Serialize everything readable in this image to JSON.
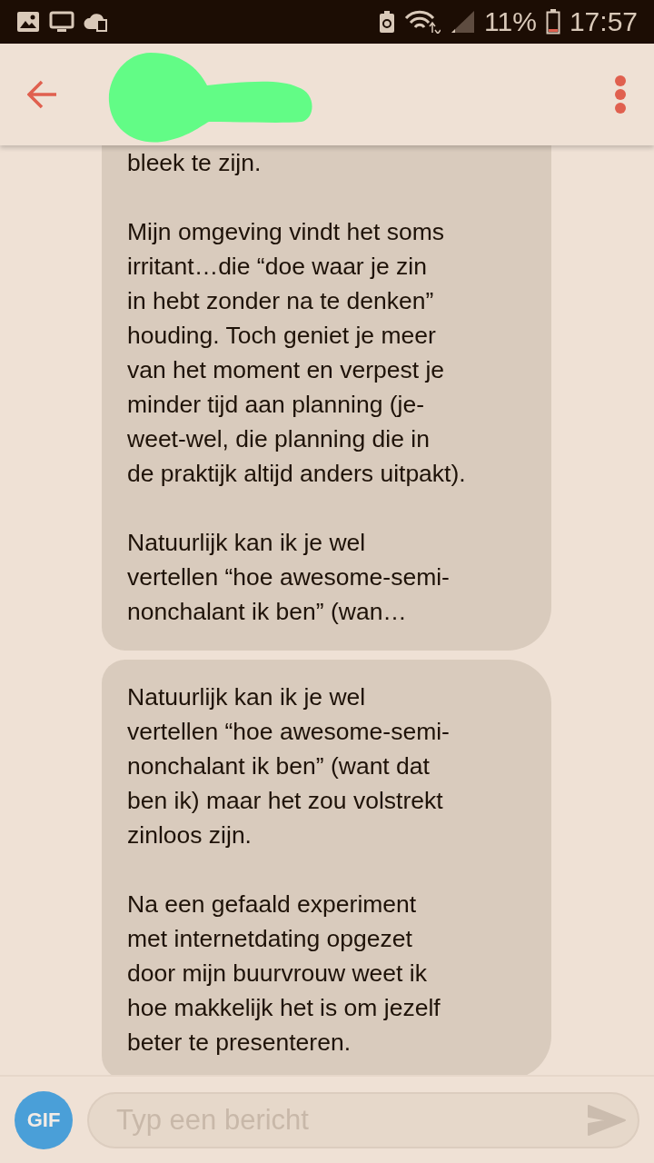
{
  "status_bar": {
    "battery": "11%",
    "time": "17:57"
  },
  "messages": [
    {
      "paragraphs": [
        "bleek te zijn.",
        "Mijn omgeving vindt het soms\nirritant…die “doe waar je zin\nin hebt zonder na te denken”\nhouding. Toch geniet je meer\nvan het moment en verpest je\nminder tijd aan planning (je-\nweet-wel, die planning die in\nde praktijk altijd anders uitpakt).",
        "Natuurlijk kan ik je wel\nvertellen “hoe awesome-semi-\nnonchalant ik ben” (wan…"
      ]
    },
    {
      "paragraphs": [
        "Natuurlijk kan ik je wel\nvertellen “hoe awesome-semi-\nnonchalant ik ben” (want dat\nben ik) maar het zou volstrekt\nzinloos zijn.",
        "Na een gefaald experiment\nmet internetdating opgezet\ndoor mijn buurvrouw weet ik\nhoe makkelijk het is om jezelf\nbeter te presenteren."
      ]
    }
  ],
  "composer": {
    "gif": "GIF",
    "placeholder": "Typ een bericht"
  }
}
